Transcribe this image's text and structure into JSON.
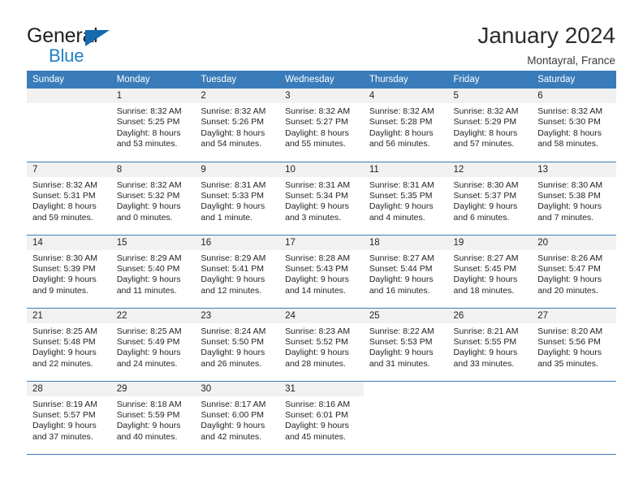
{
  "brand": {
    "name_part1": "General",
    "name_part2": "Blue",
    "flag_icon": "blue-triangle-flag-icon"
  },
  "header": {
    "title": "January 2024",
    "location": "Montayral, France"
  },
  "colors": {
    "header_blue": "#3a7cba",
    "brand_blue": "#1f7fc4",
    "daynum_bg": "#f1f1f1",
    "text": "#231f20"
  },
  "weekday_headers": [
    "Sunday",
    "Monday",
    "Tuesday",
    "Wednesday",
    "Thursday",
    "Friday",
    "Saturday"
  ],
  "weeks": [
    [
      {
        "day": "",
        "sunrise": "",
        "sunset": "",
        "daylight1": "",
        "daylight2": "",
        "blank": true
      },
      {
        "day": "1",
        "sunrise": "Sunrise: 8:32 AM",
        "sunset": "Sunset: 5:25 PM",
        "daylight1": "Daylight: 8 hours",
        "daylight2": "and 53 minutes."
      },
      {
        "day": "2",
        "sunrise": "Sunrise: 8:32 AM",
        "sunset": "Sunset: 5:26 PM",
        "daylight1": "Daylight: 8 hours",
        "daylight2": "and 54 minutes."
      },
      {
        "day": "3",
        "sunrise": "Sunrise: 8:32 AM",
        "sunset": "Sunset: 5:27 PM",
        "daylight1": "Daylight: 8 hours",
        "daylight2": "and 55 minutes."
      },
      {
        "day": "4",
        "sunrise": "Sunrise: 8:32 AM",
        "sunset": "Sunset: 5:28 PM",
        "daylight1": "Daylight: 8 hours",
        "daylight2": "and 56 minutes."
      },
      {
        "day": "5",
        "sunrise": "Sunrise: 8:32 AM",
        "sunset": "Sunset: 5:29 PM",
        "daylight1": "Daylight: 8 hours",
        "daylight2": "and 57 minutes."
      },
      {
        "day": "6",
        "sunrise": "Sunrise: 8:32 AM",
        "sunset": "Sunset: 5:30 PM",
        "daylight1": "Daylight: 8 hours",
        "daylight2": "and 58 minutes."
      }
    ],
    [
      {
        "day": "7",
        "sunrise": "Sunrise: 8:32 AM",
        "sunset": "Sunset: 5:31 PM",
        "daylight1": "Daylight: 8 hours",
        "daylight2": "and 59 minutes."
      },
      {
        "day": "8",
        "sunrise": "Sunrise: 8:32 AM",
        "sunset": "Sunset: 5:32 PM",
        "daylight1": "Daylight: 9 hours",
        "daylight2": "and 0 minutes."
      },
      {
        "day": "9",
        "sunrise": "Sunrise: 8:31 AM",
        "sunset": "Sunset: 5:33 PM",
        "daylight1": "Daylight: 9 hours",
        "daylight2": "and 1 minute."
      },
      {
        "day": "10",
        "sunrise": "Sunrise: 8:31 AM",
        "sunset": "Sunset: 5:34 PM",
        "daylight1": "Daylight: 9 hours",
        "daylight2": "and 3 minutes."
      },
      {
        "day": "11",
        "sunrise": "Sunrise: 8:31 AM",
        "sunset": "Sunset: 5:35 PM",
        "daylight1": "Daylight: 9 hours",
        "daylight2": "and 4 minutes."
      },
      {
        "day": "12",
        "sunrise": "Sunrise: 8:30 AM",
        "sunset": "Sunset: 5:37 PM",
        "daylight1": "Daylight: 9 hours",
        "daylight2": "and 6 minutes."
      },
      {
        "day": "13",
        "sunrise": "Sunrise: 8:30 AM",
        "sunset": "Sunset: 5:38 PM",
        "daylight1": "Daylight: 9 hours",
        "daylight2": "and 7 minutes."
      }
    ],
    [
      {
        "day": "14",
        "sunrise": "Sunrise: 8:30 AM",
        "sunset": "Sunset: 5:39 PM",
        "daylight1": "Daylight: 9 hours",
        "daylight2": "and 9 minutes."
      },
      {
        "day": "15",
        "sunrise": "Sunrise: 8:29 AM",
        "sunset": "Sunset: 5:40 PM",
        "daylight1": "Daylight: 9 hours",
        "daylight2": "and 11 minutes."
      },
      {
        "day": "16",
        "sunrise": "Sunrise: 8:29 AM",
        "sunset": "Sunset: 5:41 PM",
        "daylight1": "Daylight: 9 hours",
        "daylight2": "and 12 minutes."
      },
      {
        "day": "17",
        "sunrise": "Sunrise: 8:28 AM",
        "sunset": "Sunset: 5:43 PM",
        "daylight1": "Daylight: 9 hours",
        "daylight2": "and 14 minutes."
      },
      {
        "day": "18",
        "sunrise": "Sunrise: 8:27 AM",
        "sunset": "Sunset: 5:44 PM",
        "daylight1": "Daylight: 9 hours",
        "daylight2": "and 16 minutes."
      },
      {
        "day": "19",
        "sunrise": "Sunrise: 8:27 AM",
        "sunset": "Sunset: 5:45 PM",
        "daylight1": "Daylight: 9 hours",
        "daylight2": "and 18 minutes."
      },
      {
        "day": "20",
        "sunrise": "Sunrise: 8:26 AM",
        "sunset": "Sunset: 5:47 PM",
        "daylight1": "Daylight: 9 hours",
        "daylight2": "and 20 minutes."
      }
    ],
    [
      {
        "day": "21",
        "sunrise": "Sunrise: 8:25 AM",
        "sunset": "Sunset: 5:48 PM",
        "daylight1": "Daylight: 9 hours",
        "daylight2": "and 22 minutes."
      },
      {
        "day": "22",
        "sunrise": "Sunrise: 8:25 AM",
        "sunset": "Sunset: 5:49 PM",
        "daylight1": "Daylight: 9 hours",
        "daylight2": "and 24 minutes."
      },
      {
        "day": "23",
        "sunrise": "Sunrise: 8:24 AM",
        "sunset": "Sunset: 5:50 PM",
        "daylight1": "Daylight: 9 hours",
        "daylight2": "and 26 minutes."
      },
      {
        "day": "24",
        "sunrise": "Sunrise: 8:23 AM",
        "sunset": "Sunset: 5:52 PM",
        "daylight1": "Daylight: 9 hours",
        "daylight2": "and 28 minutes."
      },
      {
        "day": "25",
        "sunrise": "Sunrise: 8:22 AM",
        "sunset": "Sunset: 5:53 PM",
        "daylight1": "Daylight: 9 hours",
        "daylight2": "and 31 minutes."
      },
      {
        "day": "26",
        "sunrise": "Sunrise: 8:21 AM",
        "sunset": "Sunset: 5:55 PM",
        "daylight1": "Daylight: 9 hours",
        "daylight2": "and 33 minutes."
      },
      {
        "day": "27",
        "sunrise": "Sunrise: 8:20 AM",
        "sunset": "Sunset: 5:56 PM",
        "daylight1": "Daylight: 9 hours",
        "daylight2": "and 35 minutes."
      }
    ],
    [
      {
        "day": "28",
        "sunrise": "Sunrise: 8:19 AM",
        "sunset": "Sunset: 5:57 PM",
        "daylight1": "Daylight: 9 hours",
        "daylight2": "and 37 minutes."
      },
      {
        "day": "29",
        "sunrise": "Sunrise: 8:18 AM",
        "sunset": "Sunset: 5:59 PM",
        "daylight1": "Daylight: 9 hours",
        "daylight2": "and 40 minutes."
      },
      {
        "day": "30",
        "sunrise": "Sunrise: 8:17 AM",
        "sunset": "Sunset: 6:00 PM",
        "daylight1": "Daylight: 9 hours",
        "daylight2": "and 42 minutes."
      },
      {
        "day": "31",
        "sunrise": "Sunrise: 8:16 AM",
        "sunset": "Sunset: 6:01 PM",
        "daylight1": "Daylight: 9 hours",
        "daylight2": "and 45 minutes."
      },
      {
        "day": "",
        "sunrise": "",
        "sunset": "",
        "daylight1": "",
        "daylight2": "",
        "void": true
      },
      {
        "day": "",
        "sunrise": "",
        "sunset": "",
        "daylight1": "",
        "daylight2": "",
        "void": true
      },
      {
        "day": "",
        "sunrise": "",
        "sunset": "",
        "daylight1": "",
        "daylight2": "",
        "void": true
      }
    ]
  ]
}
